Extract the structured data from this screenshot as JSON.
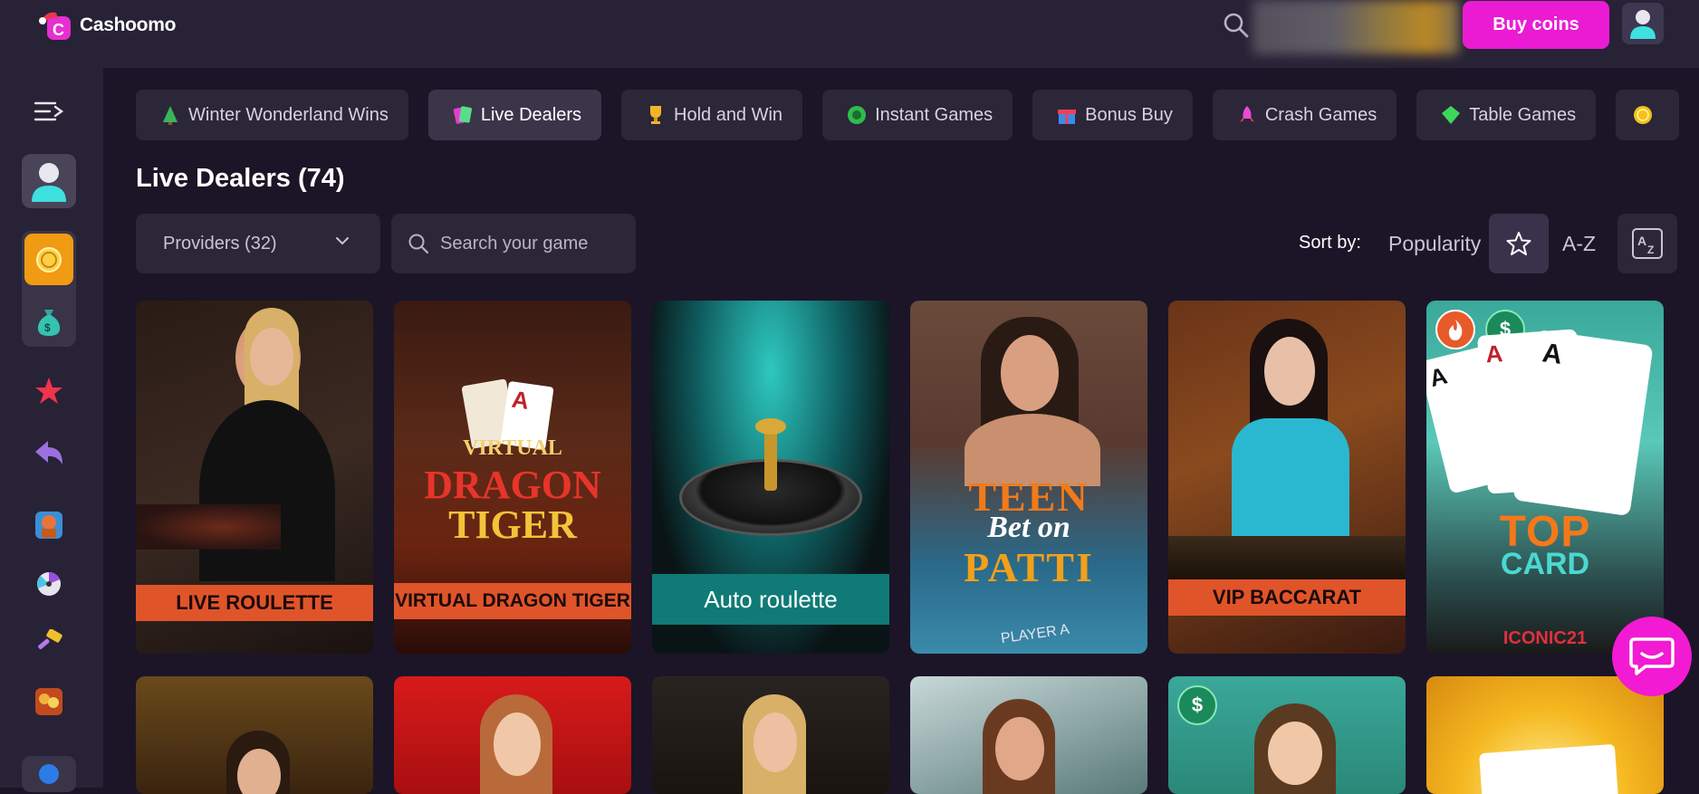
{
  "header": {
    "logo_text": "Cashoomo",
    "buy_label": "Buy coins"
  },
  "categories": [
    {
      "label": "Winter Wonderland Wins",
      "icon": "tree-icon"
    },
    {
      "label": "Live Dealers",
      "icon": "cards-icon"
    },
    {
      "label": "Hold and Win",
      "icon": "trophy-icon"
    },
    {
      "label": "Instant Games",
      "icon": "ball-icon"
    },
    {
      "label": "Bonus Buy",
      "icon": "gift-icon"
    },
    {
      "label": "Crash Games",
      "icon": "rocket-icon"
    },
    {
      "label": "Table Games",
      "icon": "gem-icon"
    }
  ],
  "page": {
    "title": "Live Dealers (74)",
    "providers_label": "Providers (32)",
    "search_placeholder": "Search your game",
    "sort_label": "Sort by:",
    "sort_popularity": "Popularity",
    "sort_az": "A-Z"
  },
  "games_row1": [
    {
      "title": "LIVE ROULETTE"
    },
    {
      "title": "VIRTUAL DRAGON TIGER",
      "art_top": "VIRTUAL",
      "art_main1": "DRAGON",
      "art_main2": "TIGER"
    },
    {
      "title": "Auto roulette"
    },
    {
      "title": "Teen Patti",
      "art_main1": "TEEN",
      "art_sub": "Bet on",
      "art_main2": "PATTI",
      "art_foot": "PLAYER A"
    },
    {
      "title": "VIP BACCARAT"
    },
    {
      "title": "Top Card",
      "art_main1": "TOP",
      "art_main2": "CARD",
      "art_foot": "ICONIC21"
    }
  ]
}
